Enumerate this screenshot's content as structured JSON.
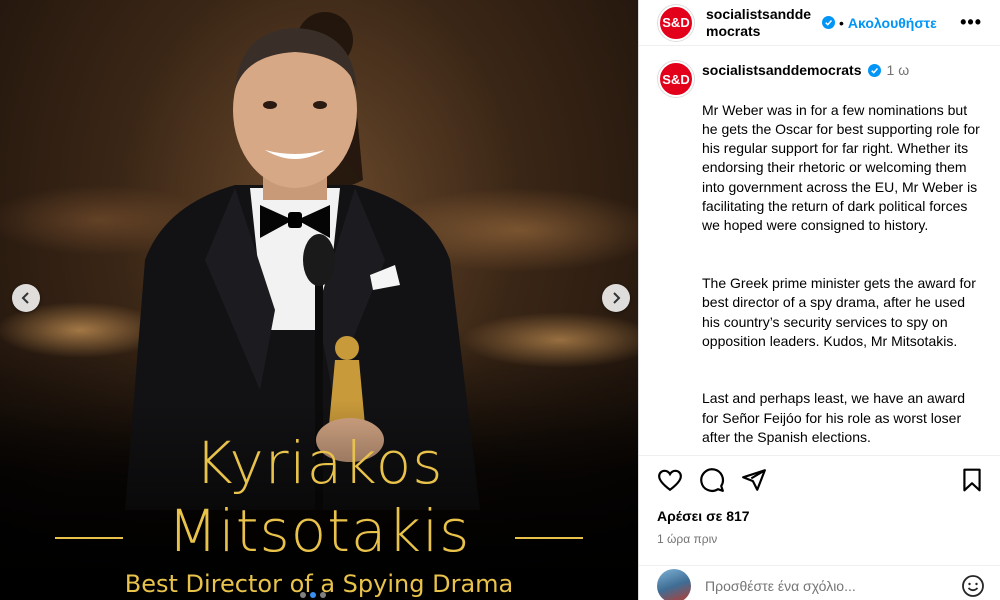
{
  "media": {
    "caption_line1": "Kyriakos",
    "caption_line2": "Mitsotakis",
    "caption_sub": "Best Director of a Spying Drama",
    "accent_color": "#e8c24a",
    "slides": 3,
    "active_slide": 2
  },
  "header": {
    "avatar_text": "S&D",
    "username": "socialistsanddemocrats",
    "follow_label": "Ακολουθήστε",
    "more_icon": "more-horizontal-icon"
  },
  "post": {
    "username": "socialistsanddemocrats",
    "time": "1 ω",
    "paragraphs": [
      "Mr Weber was in for a few nominations but he gets the Oscar for best supporting role for his regular support for far right. Whether its endorsing their rhetoric or welcoming them into government across the EU, Mr Weber is facilitating the return of dark political forces we hoped were consigned to history.",
      "The Greek prime minister gets the award for best director of a spy drama, after he used his country’s security services to spy on opposition leaders. Kudos, Mr Mitsotakis.",
      "Last and perhaps least, we have an award for Señor Feijóo for his role as worst loser after the Spanish elections."
    ]
  },
  "actions": {
    "likes": "Αρέσει σε 817",
    "time_ago": "1 ώρα πριν"
  },
  "comment": {
    "placeholder": "Προσθέστε ένα σχόλιο..."
  },
  "colors": {
    "brand_red": "#e3001b",
    "link_blue": "#0095f6",
    "muted": "#737373"
  }
}
